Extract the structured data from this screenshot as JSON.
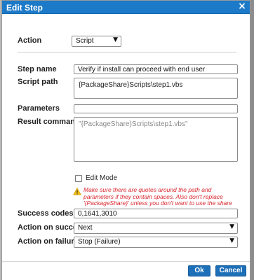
{
  "dialog": {
    "title": "Edit Step",
    "close_symbol": "×"
  },
  "form": {
    "action": {
      "label": "Action",
      "value": "Script"
    },
    "step_name": {
      "label": "Step name",
      "value": "Verify if install can proceed with end user"
    },
    "script_path": {
      "label": "Script path",
      "value": "{PackageShare}Scripts\\step1.vbs"
    },
    "parameters": {
      "label": "Parameters",
      "value": ""
    },
    "result_command": {
      "label": "Result command",
      "value": "\"{PackageShare}Scripts\\step1.vbs\""
    },
    "edit_mode": {
      "label": "Edit Mode",
      "checked": false
    },
    "warning": "Make sure there are quotes around the path and parameters if they contain spaces. Also don't replace '{PackageShare}' unless you don't want to use the share",
    "success_codes": {
      "label": "Success codes",
      "value": "0,1641,3010"
    },
    "action_on_success": {
      "label": "Action on success",
      "value": "Next"
    },
    "action_on_failure": {
      "label": "Action on failure",
      "value": "Stop (Failure)"
    }
  },
  "buttons": {
    "ok": "Ok",
    "cancel": "Cancel"
  },
  "colors": {
    "titlebar": "#1d7ac8",
    "button": "#1d6fb8",
    "warning": "#d8242c"
  }
}
